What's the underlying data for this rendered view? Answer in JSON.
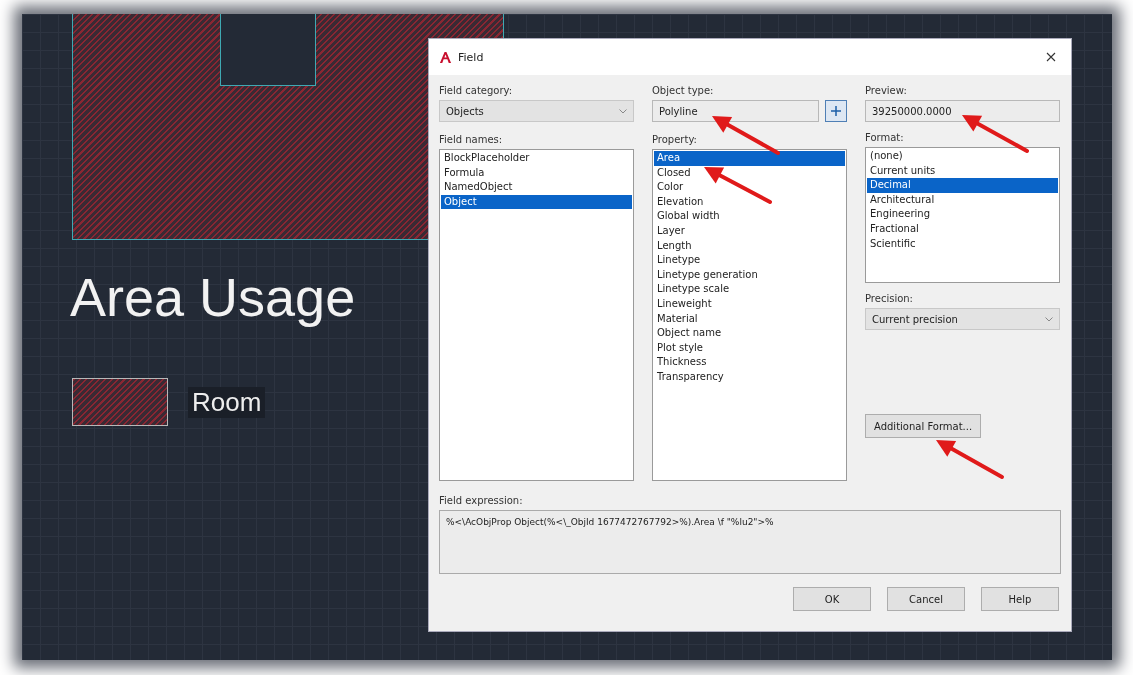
{
  "drawing": {
    "title": "Area Usage",
    "legend_label": "Room"
  },
  "dialog": {
    "title": "Field",
    "field_category": {
      "label": "Field category:",
      "value": "Objects"
    },
    "field_names": {
      "label": "Field names:",
      "items": [
        {
          "label": "BlockPlaceholder",
          "selected": false
        },
        {
          "label": "Formula",
          "selected": false
        },
        {
          "label": "NamedObject",
          "selected": false
        },
        {
          "label": "Object",
          "selected": true
        }
      ]
    },
    "object_type": {
      "label": "Object type:",
      "value": "Polyline"
    },
    "property": {
      "label": "Property:",
      "items": [
        {
          "label": "Area",
          "selected": true
        },
        {
          "label": "Closed",
          "selected": false
        },
        {
          "label": "Color",
          "selected": false
        },
        {
          "label": "Elevation",
          "selected": false
        },
        {
          "label": "Global width",
          "selected": false
        },
        {
          "label": "Layer",
          "selected": false
        },
        {
          "label": "Length",
          "selected": false
        },
        {
          "label": "Linetype",
          "selected": false
        },
        {
          "label": "Linetype generation",
          "selected": false
        },
        {
          "label": "Linetype scale",
          "selected": false
        },
        {
          "label": "Lineweight",
          "selected": false
        },
        {
          "label": "Material",
          "selected": false
        },
        {
          "label": "Object name",
          "selected": false
        },
        {
          "label": "Plot style",
          "selected": false
        },
        {
          "label": "Thickness",
          "selected": false
        },
        {
          "label": "Transparency",
          "selected": false
        }
      ]
    },
    "preview": {
      "label": "Preview:",
      "value": "39250000.0000"
    },
    "format": {
      "label": "Format:",
      "items": [
        {
          "label": "(none)",
          "selected": false
        },
        {
          "label": "Current units",
          "selected": false
        },
        {
          "label": "Decimal",
          "selected": true
        },
        {
          "label": "Architectural",
          "selected": false
        },
        {
          "label": "Engineering",
          "selected": false
        },
        {
          "label": "Fractional",
          "selected": false
        },
        {
          "label": "Scientific",
          "selected": false
        }
      ]
    },
    "precision": {
      "label": "Precision:",
      "value": "Current precision"
    },
    "additional_format_button": "Additional Format...",
    "field_expression": {
      "label": "Field expression:",
      "value": "%<\\AcObjProp Object(%<\\_ObjId 1677472767792>%).Area \\f \"%lu2\">%"
    },
    "buttons": [
      "OK",
      "Cancel",
      "Help"
    ]
  }
}
